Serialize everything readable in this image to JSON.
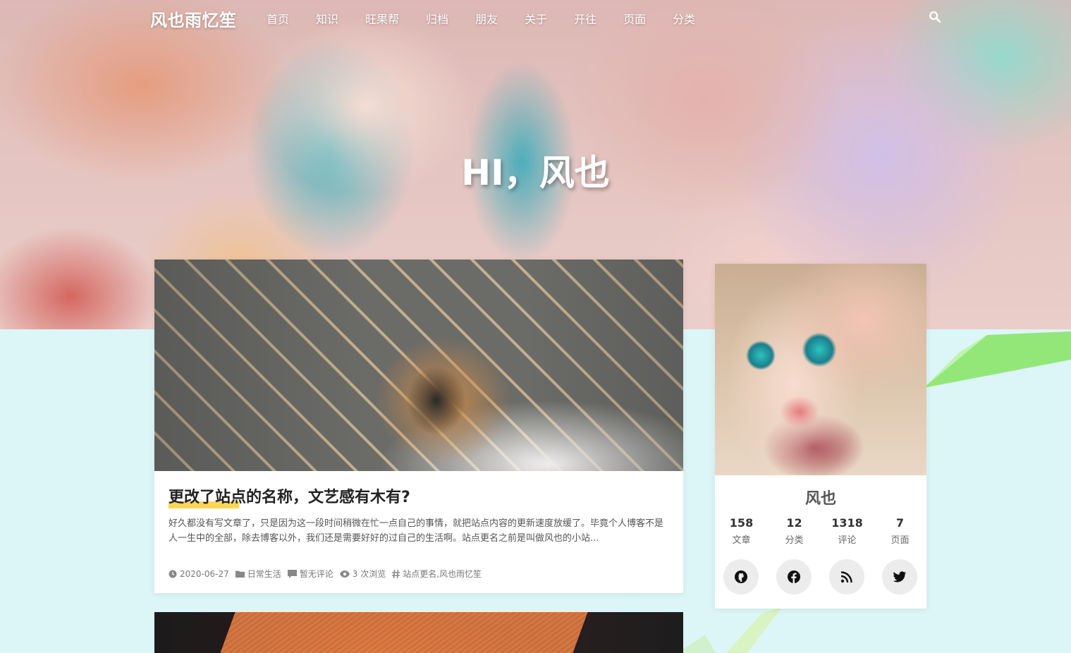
{
  "nav": {
    "brand": "风也雨忆笙",
    "items": [
      "首页",
      "知识",
      "旺果帮",
      "归档",
      "朋友",
      "关于",
      "开往",
      "页面",
      "分类"
    ]
  },
  "hero": {
    "title": "HI，风也"
  },
  "post": {
    "title": "更改了站点的名称，文艺感有木有?",
    "excerpt": "好久都没有写文章了，只是因为这一段时间稍微在忙一点自己的事情，就把站点内容的更新速度放缓了。毕竟个人博客不是人一生中的全部，除去博客以外，我们还是需要好好的过自己的生活啊。站点更名之前是叫做风也的小站...",
    "meta": {
      "date": "2020-06-27",
      "category": "日常生活",
      "comments": "暂无评论",
      "views": "3 次浏览",
      "tags": "站点更名,风也雨忆笙"
    },
    "highlight_color": "#ffd45a"
  },
  "profile": {
    "name": "风也",
    "stats": [
      {
        "num": "158",
        "label": "文章"
      },
      {
        "num": "12",
        "label": "分类"
      },
      {
        "num": "1318",
        "label": "评论"
      },
      {
        "num": "7",
        "label": "页面"
      }
    ],
    "socials": [
      "github-icon",
      "facebook-icon",
      "rss-icon",
      "twitter-icon"
    ]
  },
  "colors": {
    "page_background": "#dcf6f8",
    "accent_green": "#8be66a"
  }
}
